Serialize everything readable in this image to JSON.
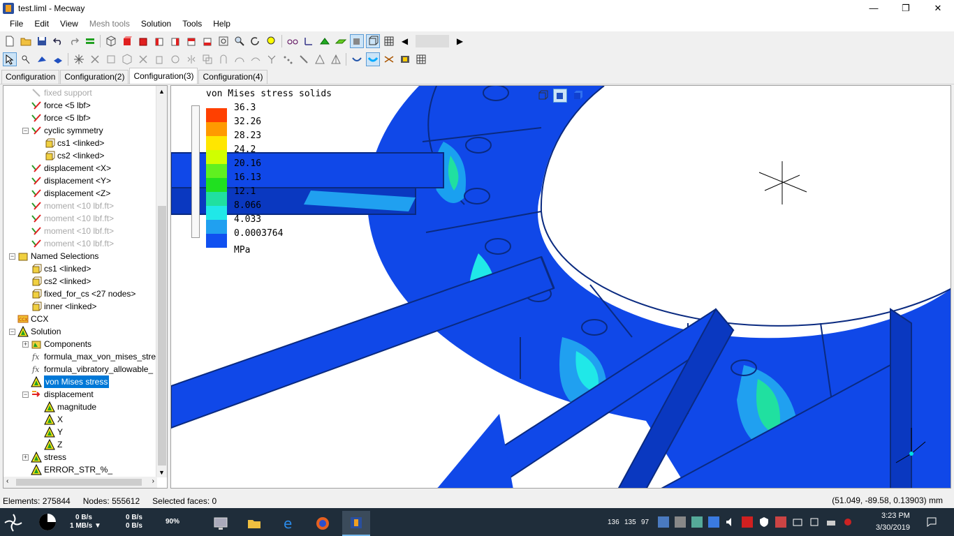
{
  "window": {
    "title": "test.liml - Mecway",
    "minimize": "—",
    "maximize": "❐",
    "close": "✕"
  },
  "menu": [
    {
      "label": "File",
      "enabled": true
    },
    {
      "label": "Edit",
      "enabled": true
    },
    {
      "label": "View",
      "enabled": true
    },
    {
      "label": "Mesh tools",
      "enabled": false
    },
    {
      "label": "Solution",
      "enabled": true
    },
    {
      "label": "Tools",
      "enabled": true
    },
    {
      "label": "Help",
      "enabled": true
    }
  ],
  "tabs": [
    "Configuration",
    "Configuration(2)",
    "Configuration(3)",
    "Configuration(4)"
  ],
  "active_tab": "Configuration(3)",
  "tree": [
    {
      "label": "fixed support",
      "indent": 1,
      "icon": "support-icon",
      "dim": true
    },
    {
      "label": "force <5 lbf>",
      "indent": 1,
      "icon": "force-icon"
    },
    {
      "label": "force <5 lbf>",
      "indent": 1,
      "icon": "force-icon"
    },
    {
      "label": "cyclic symmetry",
      "indent": 1,
      "icon": "force-icon",
      "expander": "−"
    },
    {
      "label": "cs1 <linked>",
      "indent": 2,
      "icon": "selection-icon"
    },
    {
      "label": "cs2 <linked>",
      "indent": 2,
      "icon": "selection-icon"
    },
    {
      "label": "displacement <X>",
      "indent": 1,
      "icon": "force-icon"
    },
    {
      "label": "displacement <Y>",
      "indent": 1,
      "icon": "force-icon"
    },
    {
      "label": "displacement <Z>",
      "indent": 1,
      "icon": "force-icon"
    },
    {
      "label": "moment <10 lbf.ft>",
      "indent": 1,
      "icon": "force-icon",
      "dim": true
    },
    {
      "label": "moment <10 lbf.ft>",
      "indent": 1,
      "icon": "force-icon",
      "dim": true
    },
    {
      "label": "moment <10 lbf.ft>",
      "indent": 1,
      "icon": "force-icon",
      "dim": true
    },
    {
      "label": "moment <10 lbf.ft>",
      "indent": 1,
      "icon": "force-icon",
      "dim": true
    },
    {
      "label": "Named Selections",
      "indent": 0,
      "icon": "folder-icon",
      "expander": "−"
    },
    {
      "label": "cs1 <linked>",
      "indent": 1,
      "icon": "selection-icon"
    },
    {
      "label": "cs2 <linked>",
      "indent": 1,
      "icon": "selection-icon"
    },
    {
      "label": "fixed_for_cs <27 nodes>",
      "indent": 1,
      "icon": "selection-icon"
    },
    {
      "label": "inner <linked>",
      "indent": 1,
      "icon": "selection-icon"
    },
    {
      "label": "CCX",
      "indent": 0,
      "icon": "ccx-icon"
    },
    {
      "label": "Solution",
      "indent": 0,
      "icon": "solution-icon",
      "expander": "−"
    },
    {
      "label": "Components",
      "indent": 1,
      "icon": "components-icon",
      "expander": "+"
    },
    {
      "label": "formula_max_von_mises_stre",
      "indent": 1,
      "icon": "formula-icon"
    },
    {
      "label": "formula_vibratory_allowable_",
      "indent": 1,
      "icon": "formula-icon"
    },
    {
      "label": "von Mises stress",
      "indent": 1,
      "icon": "solution-icon",
      "selected": true
    },
    {
      "label": "displacement",
      "indent": 1,
      "icon": "arrow-icon",
      "expander": "−"
    },
    {
      "label": "magnitude",
      "indent": 2,
      "icon": "solution-icon"
    },
    {
      "label": "X",
      "indent": 2,
      "icon": "solution-icon"
    },
    {
      "label": "Y",
      "indent": 2,
      "icon": "solution-icon"
    },
    {
      "label": "Z",
      "indent": 2,
      "icon": "solution-icon"
    },
    {
      "label": "stress",
      "indent": 1,
      "icon": "solution-icon",
      "expander": "+"
    },
    {
      "label": "ERROR_STR_%_",
      "indent": 1,
      "icon": "solution-icon"
    }
  ],
  "legend": {
    "title": "von Mises stress solids",
    "values": [
      "36.3",
      "32.26",
      "28.23",
      "24.2",
      "20.16",
      "16.13",
      "12.1",
      "8.066",
      "4.033",
      "0.0003764"
    ],
    "colors": [
      "#ff4000",
      "#ff9a00",
      "#ffe600",
      "#d0ff00",
      "#60f020",
      "#20e020",
      "#20e0a0",
      "#20e8e8",
      "#20a0f0",
      "#1050f0"
    ],
    "unit": "MPa"
  },
  "status": {
    "elements": "Elements: 275844",
    "nodes": "Nodes: 555612",
    "faces": "Selected faces: 0",
    "coords": "(51.049, -89.58, 0.13903) mm"
  },
  "taskbar": {
    "net_up": "0 B/s",
    "net_down": "1 MB/s ▼",
    "disk_read": "0 B/s",
    "disk_write": "0 B/s",
    "cpu": "90%",
    "temps": [
      "136",
      "135",
      "97"
    ],
    "time": "3:23 PM",
    "date": "3/30/2019"
  }
}
